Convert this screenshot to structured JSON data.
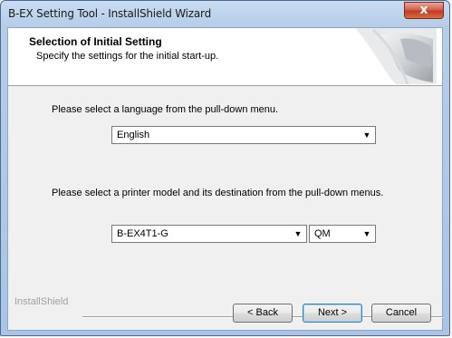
{
  "window": {
    "title": "B-EX Setting Tool - InstallShield Wizard",
    "close_glyph": "x"
  },
  "header": {
    "title": "Selection of Initial Setting",
    "subtitle": "Specify the settings for the initial start-up."
  },
  "language": {
    "prompt": "Please select a language from the pull-down menu.",
    "selected": "English"
  },
  "printer": {
    "prompt": "Please select a printer model and its destination from the pull-down menus.",
    "model_selected": "B-EX4T1-G",
    "destination_selected": "QM"
  },
  "footer": {
    "brand": "InstallShield",
    "back_label": "< Back",
    "next_label": "Next >",
    "cancel_label": "Cancel"
  },
  "icons": {
    "dropdown": "chevron-down-icon",
    "close": "close-icon"
  }
}
